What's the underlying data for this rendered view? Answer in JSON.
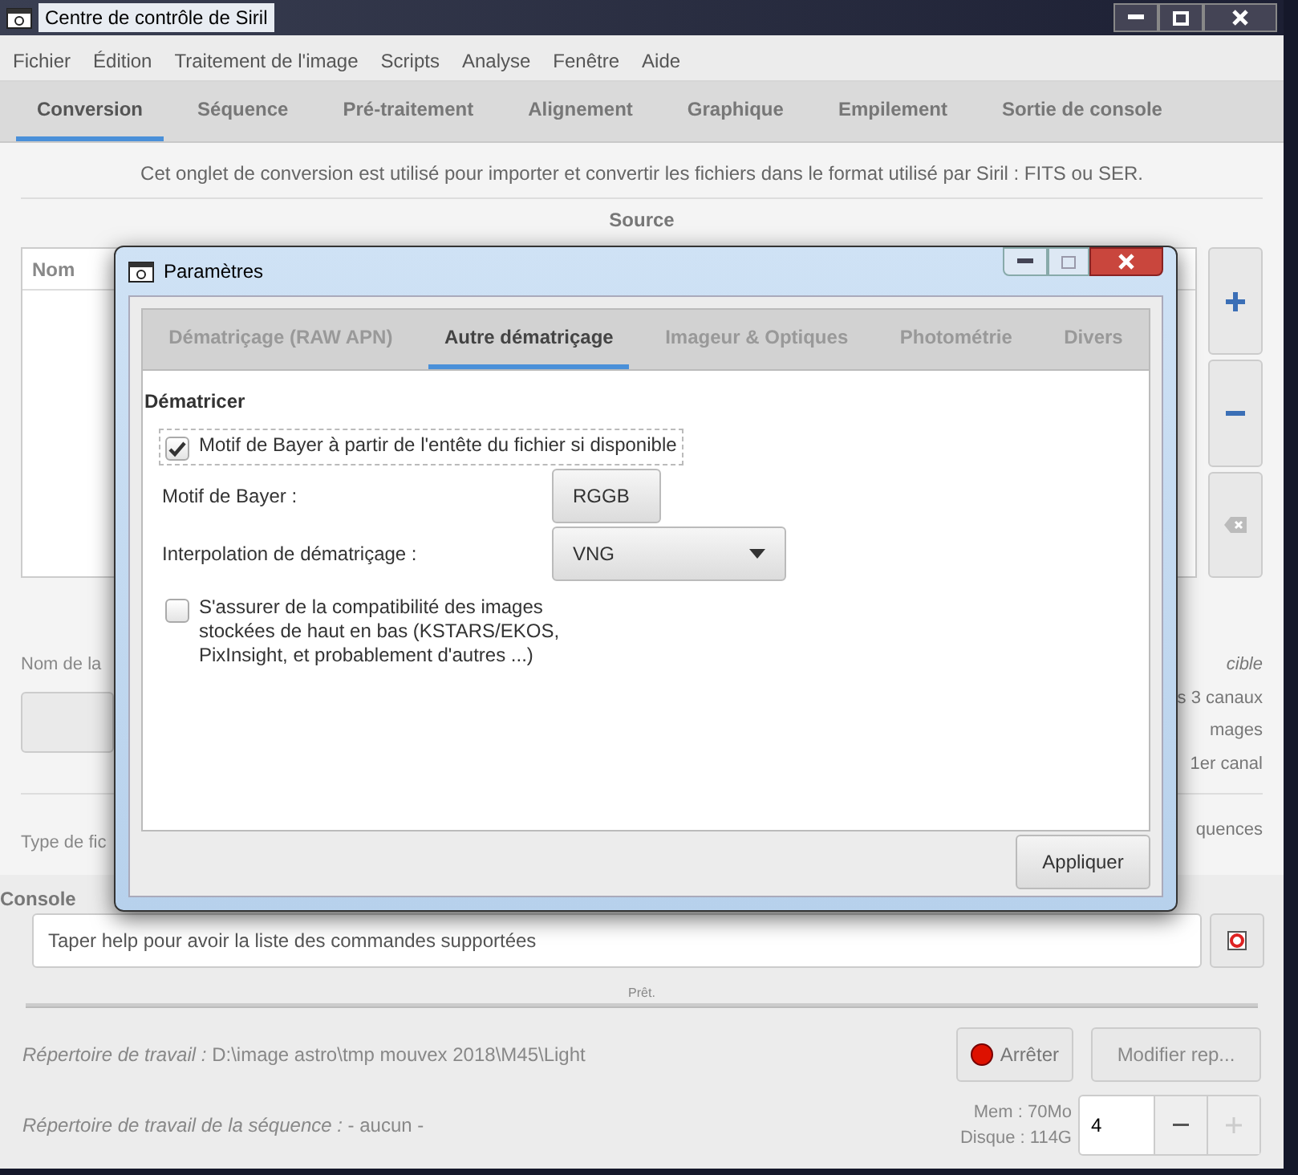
{
  "window": {
    "title": "Centre de contrôle de Siril"
  },
  "menu": [
    "Fichier",
    "Édition",
    "Traitement de l'image",
    "Scripts",
    "Analyse",
    "Fenêtre",
    "Aide"
  ],
  "tabs": [
    {
      "label": "Conversion",
      "selected": true
    },
    {
      "label": "Séquence",
      "selected": false
    },
    {
      "label": "Pré-traitement",
      "selected": false
    },
    {
      "label": "Alignement",
      "selected": false
    },
    {
      "label": "Graphique",
      "selected": false
    },
    {
      "label": "Empilement",
      "selected": false
    },
    {
      "label": "Sortie de console",
      "selected": false
    }
  ],
  "conversion": {
    "info": "Cet onglet de conversion est utilisé pour importer et convertir les fichiers dans le format utilisé par Siril : FITS ou SER.",
    "source_heading": "Source",
    "file_list": {
      "columns": [
        "Nom"
      ]
    },
    "left_labels": [
      "Nom de la",
      "Type de fic"
    ],
    "right_labels": [
      {
        "text": "cible",
        "italic": true
      },
      {
        "text": "s 3 canaux",
        "italic": false
      },
      {
        "text": "mages",
        "italic": false
      },
      {
        "text": "1er canal",
        "italic": false
      }
    ],
    "right_label_lower": "quences"
  },
  "console": {
    "label": "Console",
    "placeholder": "Taper help pour avoir la liste des commandes supportées"
  },
  "status": "Prêt.",
  "progress": {
    "level": 0
  },
  "working_dir": {
    "label": "Répertoire de travail :",
    "value": "D:\\image astro\\tmp mouvex 2018\\M45\\Light"
  },
  "sequence_dir": {
    "label": "Répertoire de travail de la séquence :",
    "value": "- aucun -"
  },
  "stop_button": "Arrêter",
  "change_dir_button": "Modifier rep...",
  "memory": "Mem : 70Mo",
  "disk": "Disque : 114G",
  "threads": {
    "value": "4"
  },
  "dialog": {
    "title": "Paramètres",
    "tabs": [
      {
        "label": "Dématriçage (RAW APN)",
        "selected": false
      },
      {
        "label": "Autre dématriçage",
        "selected": true
      },
      {
        "label": "Imageur & Optiques",
        "selected": false
      },
      {
        "label": "Photométrie",
        "selected": false
      },
      {
        "label": "Divers",
        "selected": false
      }
    ],
    "section": "Dématricer",
    "options": [
      {
        "kind": "checkbox",
        "label": "Motif de Bayer à partir de l'entête du fichier si disponible",
        "checked": true,
        "focused": true
      },
      {
        "kind": "dropdown",
        "label": "Motif de Bayer :",
        "value": "RGGB"
      },
      {
        "kind": "dropdown",
        "label": "Interpolation de dématriçage :",
        "value": "VNG"
      },
      {
        "kind": "checkbox",
        "label": "S'assurer de la compatibilité des images stockées de haut en bas (KSTARS/EKOS, PixInsight, et probablement d'autres ...)",
        "checked": false,
        "focused": false
      }
    ],
    "apply_button": "Appliquer"
  }
}
